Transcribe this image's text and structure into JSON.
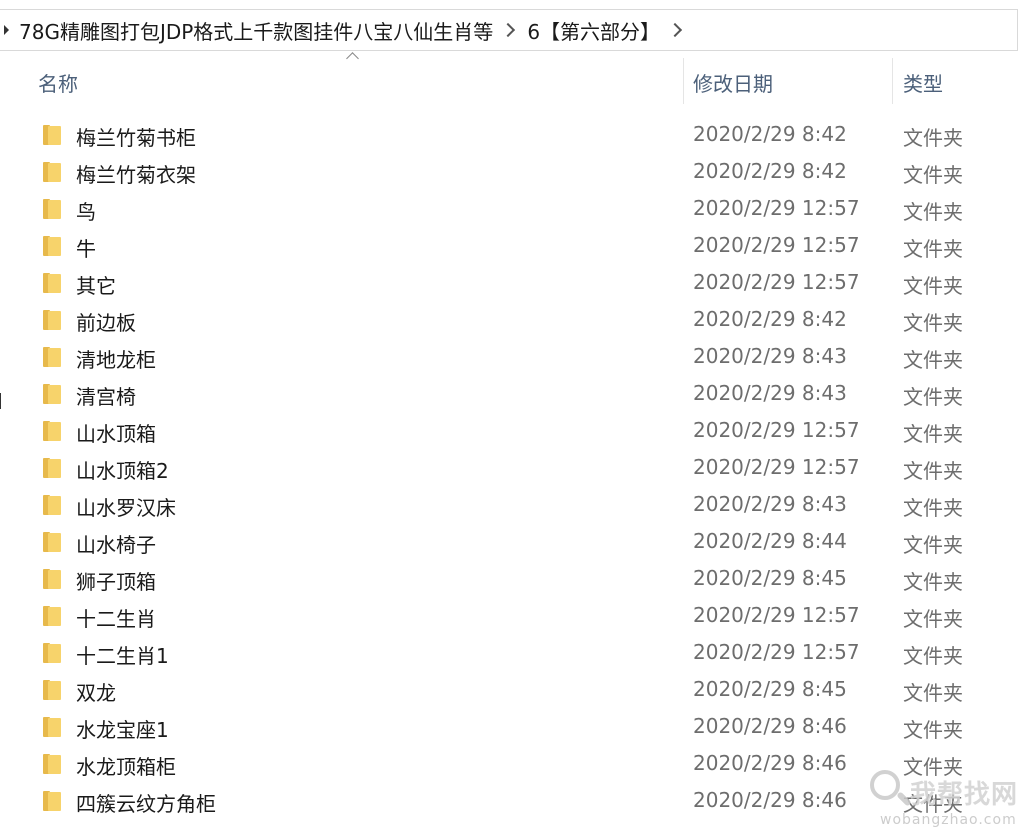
{
  "breadcrumb": {
    "parent": "78G精雕图打包JDP格式上千款图挂件八宝八仙生肖等",
    "current": "6【第六部分】"
  },
  "columns": {
    "name": "名称",
    "modified": "修改日期",
    "type": "类型"
  },
  "files": [
    {
      "name": "梅兰竹菊书柜",
      "date": "2020/2/29 8:42",
      "type": "文件夹"
    },
    {
      "name": "梅兰竹菊衣架",
      "date": "2020/2/29 8:42",
      "type": "文件夹"
    },
    {
      "name": "鸟",
      "date": "2020/2/29 12:57",
      "type": "文件夹"
    },
    {
      "name": "牛",
      "date": "2020/2/29 12:57",
      "type": "文件夹"
    },
    {
      "name": "其它",
      "date": "2020/2/29 12:57",
      "type": "文件夹"
    },
    {
      "name": "前边板",
      "date": "2020/2/29 8:42",
      "type": "文件夹"
    },
    {
      "name": "清地龙柜",
      "date": "2020/2/29 8:43",
      "type": "文件夹"
    },
    {
      "name": "清宫椅",
      "date": "2020/2/29 8:43",
      "type": "文件夹"
    },
    {
      "name": "山水顶箱",
      "date": "2020/2/29 12:57",
      "type": "文件夹"
    },
    {
      "name": "山水顶箱2",
      "date": "2020/2/29 12:57",
      "type": "文件夹"
    },
    {
      "name": "山水罗汉床",
      "date": "2020/2/29 8:43",
      "type": "文件夹"
    },
    {
      "name": "山水椅子",
      "date": "2020/2/29 8:44",
      "type": "文件夹"
    },
    {
      "name": "狮子顶箱",
      "date": "2020/2/29 8:45",
      "type": "文件夹"
    },
    {
      "name": "十二生肖",
      "date": "2020/2/29 12:57",
      "type": "文件夹"
    },
    {
      "name": "十二生肖1",
      "date": "2020/2/29 12:57",
      "type": "文件夹"
    },
    {
      "name": "双龙",
      "date": "2020/2/29 8:45",
      "type": "文件夹"
    },
    {
      "name": "水龙宝座1",
      "date": "2020/2/29 8:46",
      "type": "文件夹"
    },
    {
      "name": "水龙顶箱柜",
      "date": "2020/2/29 8:46",
      "type": "文件夹"
    },
    {
      "name": "四簇云纹方角柜",
      "date": "2020/2/29 8:46",
      "type": "文件夹"
    }
  ],
  "watermark": {
    "title": "我帮找网",
    "domain": "wobangzhao.com"
  },
  "icons": {
    "folder": "folder-icon",
    "breadcrumb_chevron": "chevron-right-icon",
    "sort": "sort-ascending-icon"
  },
  "colors": {
    "folder_front": "#f7d36b",
    "folder_back": "#e7b94b",
    "header_text": "#4c607a",
    "secondary_text": "#6d6d6d"
  }
}
